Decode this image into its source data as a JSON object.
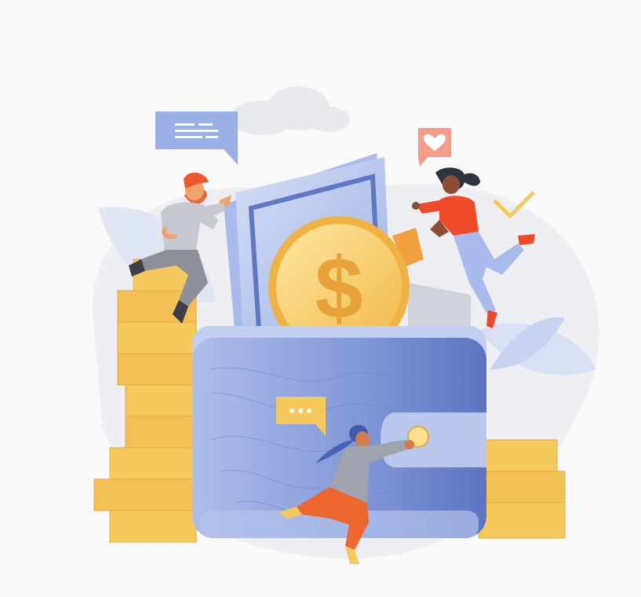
{
  "illustration": {
    "subject": "wallet-with-coins",
    "colors": {
      "background": "#f9f9fa",
      "blob": "#eeeff2",
      "wallet": "#7f97d6",
      "wallet_dark": "#5e76c1",
      "wallet_light": "#c5d1f0",
      "coin": "#f5c75f",
      "coin_light": "#fbe08e",
      "coin_dark": "#e8a93c",
      "accent": "#f0603a",
      "check": "#f2c94c",
      "leaf": "#dfe5f6"
    },
    "icons": [
      "chat-lines-icon",
      "heart-icon",
      "checkmark-icon",
      "dots-icon",
      "dollar-icon"
    ]
  }
}
